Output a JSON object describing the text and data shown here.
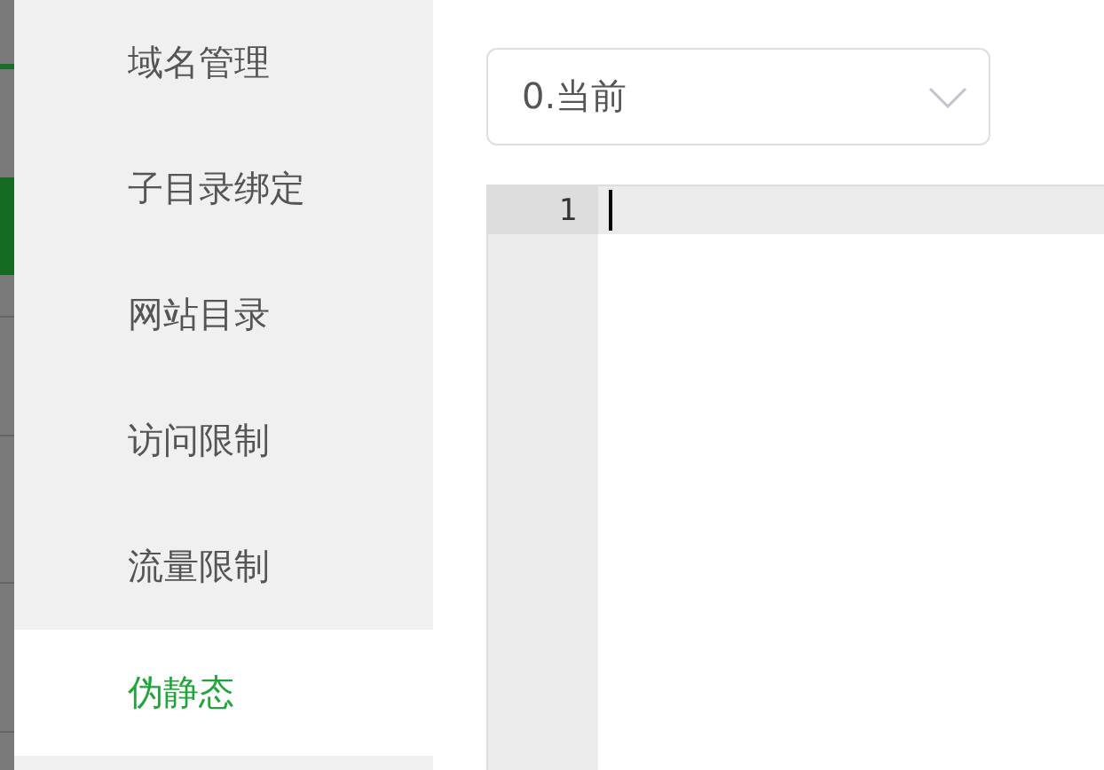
{
  "sidebar": {
    "items": [
      {
        "label": "域名管理",
        "selected": false
      },
      {
        "label": "子目录绑定",
        "selected": false
      },
      {
        "label": "网站目录",
        "selected": false
      },
      {
        "label": "访问限制",
        "selected": false
      },
      {
        "label": "流量限制",
        "selected": false
      },
      {
        "label": "伪静态",
        "selected": true
      }
    ]
  },
  "version_select": {
    "value": "0.当前"
  },
  "editor": {
    "lines": [
      {
        "number": "1",
        "active": true
      }
    ]
  }
}
